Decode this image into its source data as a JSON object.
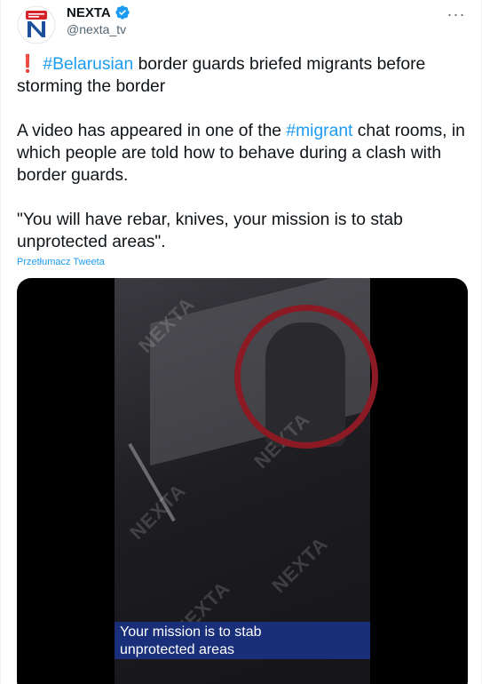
{
  "tweet": {
    "author": {
      "display_name": "NEXTA",
      "handle": "@nexta_tv",
      "verified": true
    },
    "more_glyph": "···",
    "text": {
      "line1_prefix": "❗",
      "line1_hashtag": "#Belarusian",
      "line1_rest": " border guards briefed migrants before storming the border",
      "para2_a": "A video has appeared in one of the ",
      "para2_hashtag": "#migrant",
      "para2_b": " chat rooms, in which people are told how to behave during a clash with border guards.",
      "quote": "\"You will have rebar, knives, your mission is to stab unprotected areas\"."
    },
    "translate_link": "Przetłumacz Tweeta",
    "media": {
      "watermark": "NEXTA",
      "caption_line1": "Your mission is to stab",
      "caption_line2": "unprotected areas"
    }
  },
  "colors": {
    "link": "#1d9bf0",
    "text": "#0f1419",
    "muted": "#536471",
    "circle": "#8b1a24",
    "caption_bg": "#1a2f7a"
  }
}
